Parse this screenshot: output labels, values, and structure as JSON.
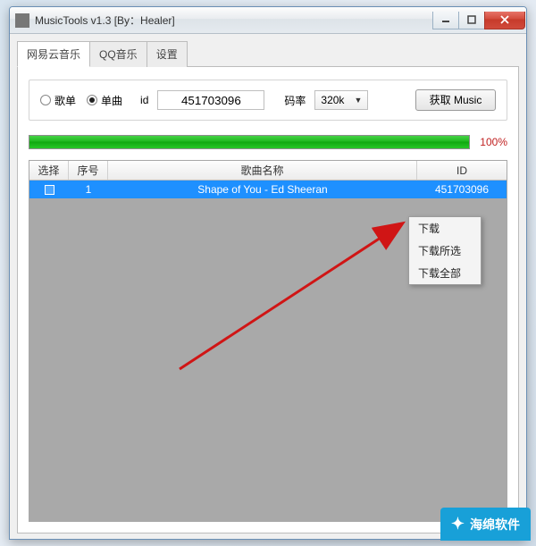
{
  "window": {
    "title": "MusicTools v1.3 [By：Healer]"
  },
  "tabs": [
    {
      "label": "网易云音乐",
      "active": true
    },
    {
      "label": "QQ音乐",
      "active": false
    },
    {
      "label": "设置",
      "active": false
    }
  ],
  "controls": {
    "radio_gedan": "歌单",
    "radio_danqu": "单曲",
    "radio_selected": "单曲",
    "id_label": "id",
    "id_value": "451703096",
    "bitrate_label": "码率",
    "bitrate_value": "320k",
    "get_button": "获取 Music"
  },
  "progress": {
    "percent": 100,
    "label": "100%"
  },
  "table": {
    "headers": {
      "select": "选择",
      "index": "序号",
      "name": "歌曲名称",
      "id": "ID"
    },
    "rows": [
      {
        "checked": true,
        "index": "1",
        "name": "Shape of You - Ed Sheeran",
        "id": "451703096"
      }
    ]
  },
  "context_menu": {
    "items": [
      "下载",
      "下载所选",
      "下载全部"
    ]
  },
  "watermark": {
    "text": "海绵软件"
  }
}
